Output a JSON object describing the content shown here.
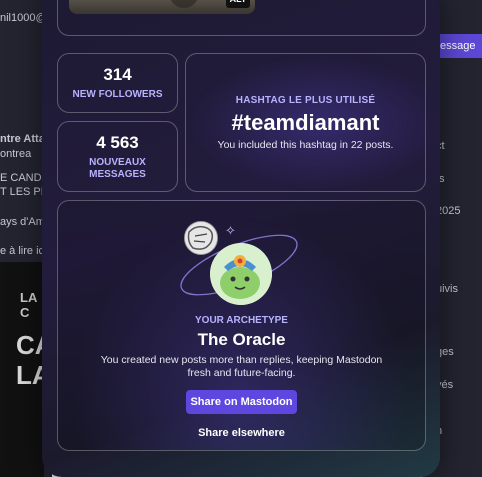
{
  "background": {
    "left_lines": [
      "nil1000@",
      "ntre Attac",
      "ontrea",
      "E CANDID",
      "T LES PR",
      "ays d'Am",
      "e à lire ic"
    ],
    "right_lines": [
      "essage",
      "ct",
      "ts",
      "2025",
      "uivis",
      "ges",
      "vés",
      "n"
    ],
    "poster_text": "CA\nLA",
    "poster_banner": "LA C"
  },
  "top_card": {
    "alt_badge": "ALT"
  },
  "stats": {
    "followers": {
      "value": "314",
      "label": "NEW FOLLOWERS"
    },
    "messages": {
      "value": "4 563",
      "label": "NOUVEAUX MESSAGES"
    }
  },
  "hashtag": {
    "eyebrow": "HASHTAG LE PLUS UTILISÉ",
    "tag": "#teamdiamant",
    "description": "You included this hashtag in 22 posts."
  },
  "archetype": {
    "eyebrow": "YOUR ARCHETYPE",
    "title": "The Oracle",
    "description": "You created new posts more than replies, keeping Mastodon fresh and future-facing.",
    "share_primary": "Share on Mastodon",
    "share_secondary": "Share elsewhere"
  },
  "colors": {
    "accent": "#5d47de",
    "label": "#b9b2ff"
  }
}
